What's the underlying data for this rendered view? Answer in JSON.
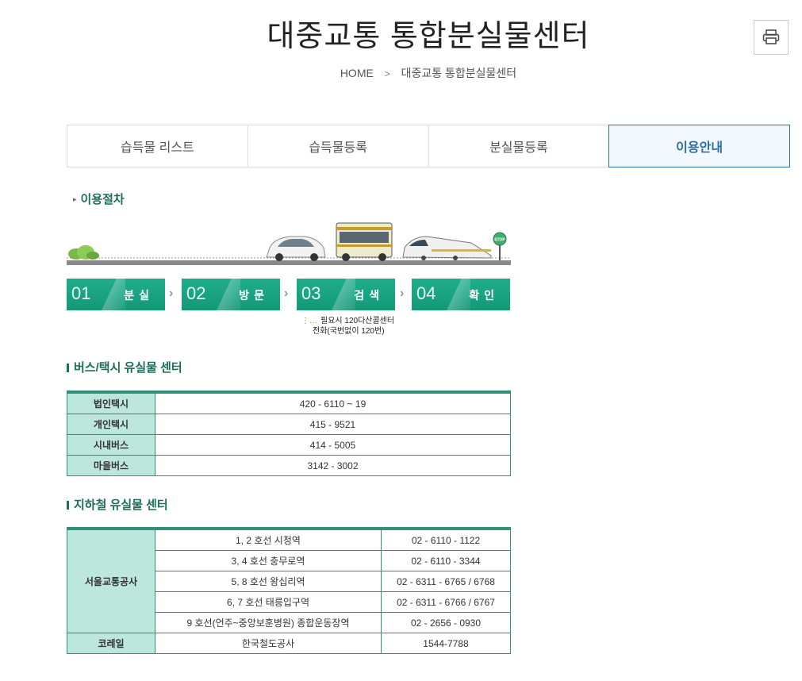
{
  "page": {
    "title": "대중교통 통합분실물센터"
  },
  "breadcrumb": {
    "home": "HOME",
    "separator": ">",
    "current": "대중교통 통합분실물센터"
  },
  "tabs": [
    {
      "label": "습득물 리스트"
    },
    {
      "label": "습득물등록"
    },
    {
      "label": "분실물등록"
    },
    {
      "label": "이용안내"
    }
  ],
  "active_tab": "이용안내",
  "procedure": {
    "title": "이용절차",
    "steps": [
      {
        "num": "01",
        "label": "분실"
      },
      {
        "num": "02",
        "label": "방문"
      },
      {
        "num": "03",
        "label": "검색"
      },
      {
        "num": "04",
        "label": "확인"
      }
    ],
    "note_line1": "필요시 120다산콜센터",
    "note_line2": "전화(국번없이 120번)",
    "stop_sign": "STOP"
  },
  "bus_taxi": {
    "title": "버스/택시 유실물 센터",
    "rows": [
      {
        "label": "법인택시",
        "phone": "420 - 6110 ~ 19"
      },
      {
        "label": "개인택시",
        "phone": "415 - 9521"
      },
      {
        "label": "시내버스",
        "phone": "414 - 5005"
      },
      {
        "label": "마을버스",
        "phone": "3142 - 3002"
      }
    ]
  },
  "subway": {
    "title": "지하철 유실물 센터",
    "operator1": "서울교통공사",
    "rows": [
      {
        "line": "1, 2 호선 시청역",
        "phone": "02 - 6110 - 1122"
      },
      {
        "line": "3, 4 호선 충무로역",
        "phone": "02 - 6110 - 3344"
      },
      {
        "line": "5, 8 호선 왕십리역",
        "phone": "02 - 6311 - 6765 / 6768"
      },
      {
        "line": "6, 7 호선 태릉입구역",
        "phone": "02 - 6311 - 6766 / 6767"
      },
      {
        "line": "9 호선(언주~중앙보훈병원) 종합운동장역",
        "phone": "02 - 2656 - 0930"
      }
    ],
    "korail": {
      "label": "코레일",
      "name": "한국철도공사",
      "phone": "1544-7788"
    }
  },
  "colors": {
    "accent_green": "#1d6d5a",
    "active_tab_blue": "#2b6fa8",
    "table_head": "#bde7dd",
    "step_green": "#1fae8b"
  },
  "icons": {
    "print": "printer-icon",
    "breadcrumb_sep": "chevron-right-icon"
  }
}
